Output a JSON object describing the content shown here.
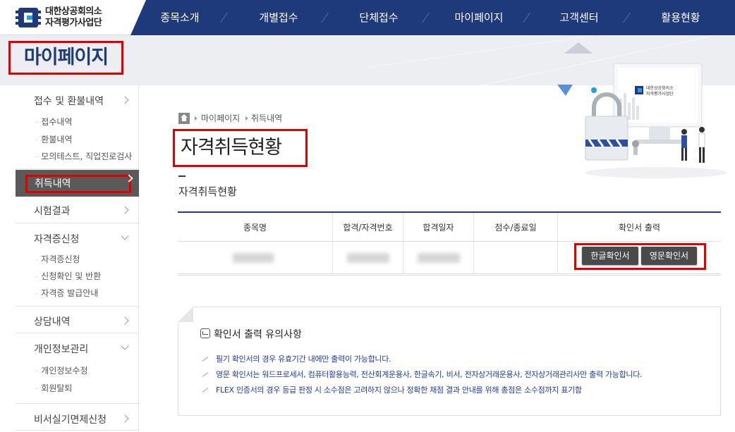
{
  "logo": {
    "line1": "대한상공회의소",
    "line2": "자격평가사업단"
  },
  "nav": {
    "items": [
      "종목소개",
      "개별접수",
      "단체접수",
      "마이페이지",
      "고객센터",
      "활용현황"
    ]
  },
  "hero": {
    "title": "마이페이지"
  },
  "sidebar": {
    "groups": [
      {
        "label": "접수 및 환불내역",
        "subs": [
          "접수내역",
          "환불내역",
          "모의테스트, 직업진로검사"
        ]
      },
      {
        "label": "취득내역",
        "active": true
      },
      {
        "label": "시험결과"
      },
      {
        "label": "자격증신청",
        "subs": [
          "자격증신청",
          "신청확인 및 반환",
          "자격증 발급안내"
        ]
      },
      {
        "label": "상담내역"
      },
      {
        "label": "개인정보관리",
        "subs": [
          "개인정보수정",
          "회원탈퇴"
        ]
      },
      {
        "label": "비서실기면제신청"
      }
    ]
  },
  "breadcrumb": {
    "items": [
      "마이페이지",
      "취득내역"
    ]
  },
  "page": {
    "title": "자격취득현황",
    "section_title": "자격취득현황"
  },
  "table": {
    "headers": [
      "종목명",
      "합격/자격번호",
      "합격일자",
      "점수/종료일",
      "확인서 출력"
    ],
    "buttons": {
      "korean": "한글확인서",
      "english": "영문확인서"
    }
  },
  "notice": {
    "title": "확인서 출력 유의사항",
    "items": [
      "필기 확인서의 경우 유효기간 내에만 출력이 가능합니다.",
      "영문 확인서는 워드프로세서, 컴퓨터활용능력, 전산회계운용사, 한글속기, 비서, 전자상거래운용사, 전자상거래관리사만 출력 가능합니다.",
      "FLEX 인증서의 경우 등급 판정 시 소수점은 고려하지 않으나 정확한 채점 결과 안내를 위해 총점은 소수점까지 표기함"
    ]
  },
  "illustration": {
    "monitor_line1": "대한상공회의소",
    "monitor_line2": "자격평가사업단"
  },
  "colors": {
    "nav_bg": "#1f3a7a",
    "highlight": "#e00000",
    "sidebar_active": "#5a5a5a",
    "button_bg": "#4a4a4a"
  }
}
